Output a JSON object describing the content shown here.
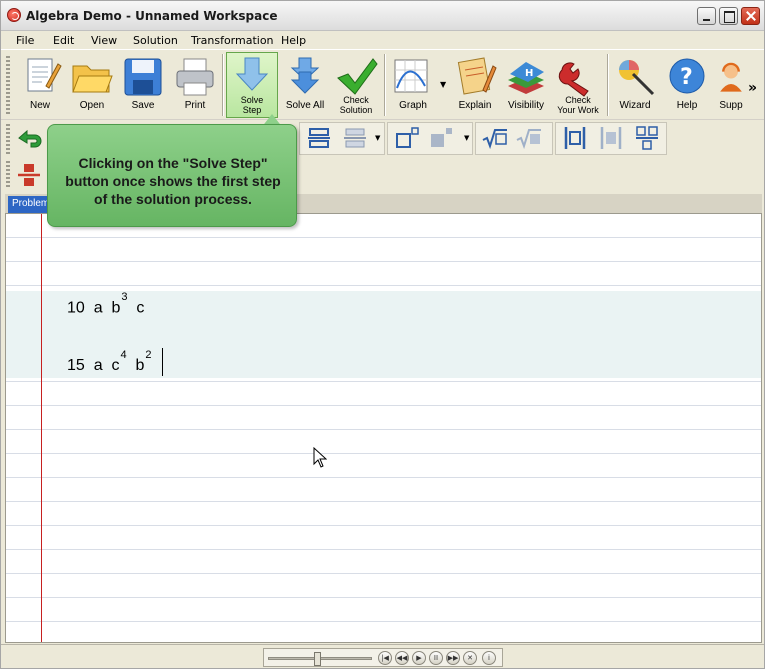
{
  "window": {
    "title": "Algebra Demo - Unnamed Workspace"
  },
  "menu": [
    "File",
    "Edit",
    "View",
    "Solution",
    "Transformation",
    "Help"
  ],
  "toolbar": {
    "new": "New",
    "open": "Open",
    "save": "Save",
    "print": "Print",
    "solve_step": "Solve\nStep",
    "solve_all": "Solve All",
    "check_solution": "Check\nSolution",
    "graph": "Graph",
    "explain": "Explain",
    "visibility": "Visibility",
    "check_your_work": "Check\nYour Work",
    "wizard": "Wizard",
    "help": "Help",
    "support": "Supp",
    "overflow": "»"
  },
  "tab": {
    "label": "Problem"
  },
  "callout": {
    "text": "Clicking on the \"Solve Step\" button once shows the first step of the solution process."
  },
  "worksheet": {
    "line1": {
      "coef": "10",
      "terms": [
        {
          "v": "a",
          "e": ""
        },
        {
          "v": "b",
          "e": "3"
        },
        {
          "v": "c",
          "e": ""
        }
      ]
    },
    "line2": {
      "coef": "15",
      "terms": [
        {
          "v": "a",
          "e": ""
        },
        {
          "v": "c",
          "e": "4"
        },
        {
          "v": "b",
          "e": "2"
        }
      ]
    }
  },
  "colors": {
    "accent_green": "#8ed08a",
    "tab_blue": "#2d66c4",
    "margin_red": "#c62020"
  }
}
